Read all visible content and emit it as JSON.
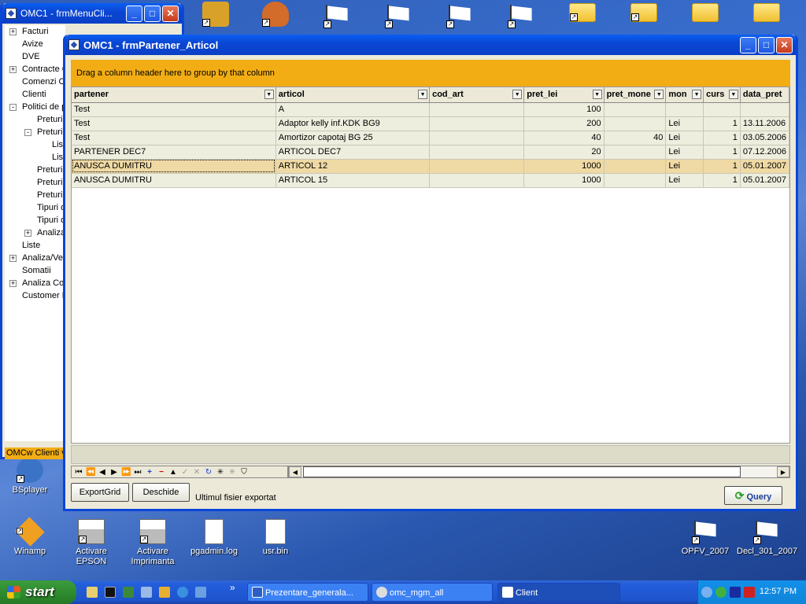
{
  "desktop": {
    "icons": [
      {
        "name": "bsplayer",
        "label": "BSplayer"
      },
      {
        "name": "winamp",
        "label": "Winamp"
      },
      {
        "name": "activare-epson",
        "label": "Activare EPSON"
      },
      {
        "name": "activare-imprimanta",
        "label": "Activare Imprimanta"
      },
      {
        "name": "pgadmin-log",
        "label": "pgadmin.log"
      },
      {
        "name": "usr-bin",
        "label": "usr.bin"
      },
      {
        "name": "opfv-2007",
        "label": "OPFV_2007"
      },
      {
        "name": "decl-301-2007",
        "label": "Decl_301_2007"
      }
    ]
  },
  "tree_window": {
    "title": "OMC1 - frmMenuCli...",
    "items": [
      {
        "label": "Facturi",
        "level": 0,
        "toggle": "+"
      },
      {
        "label": "Avize",
        "level": 0,
        "toggle": ""
      },
      {
        "label": "DVE",
        "level": 0,
        "toggle": ""
      },
      {
        "label": "Contracte C",
        "level": 0,
        "toggle": "+"
      },
      {
        "label": "Comenzi Cli",
        "level": 0,
        "toggle": ""
      },
      {
        "label": "Clienti",
        "level": 0,
        "toggle": ""
      },
      {
        "label": "Politici de p",
        "level": 0,
        "toggle": "-"
      },
      {
        "label": "Preturi d",
        "level": 1,
        "toggle": ""
      },
      {
        "label": "Preturi p",
        "level": 1,
        "toggle": "-"
      },
      {
        "label": "List",
        "level": 2,
        "toggle": ""
      },
      {
        "label": "List",
        "level": 2,
        "toggle": ""
      },
      {
        "label": "Preturi p",
        "level": 1,
        "toggle": ""
      },
      {
        "label": "Preturi p",
        "level": 1,
        "toggle": ""
      },
      {
        "label": "Preturi p",
        "level": 1,
        "toggle": ""
      },
      {
        "label": "Tipuri d",
        "level": 1,
        "toggle": ""
      },
      {
        "label": "Tipuri d",
        "level": 1,
        "toggle": ""
      },
      {
        "label": "Analiza",
        "level": 1,
        "toggle": "+"
      },
      {
        "label": "Liste",
        "level": 0,
        "toggle": ""
      },
      {
        "label": "Analiza/Ver",
        "level": 0,
        "toggle": "+"
      },
      {
        "label": "Somatii",
        "level": 0,
        "toggle": ""
      },
      {
        "label": "Analiza Cor",
        "level": 0,
        "toggle": "+"
      },
      {
        "label": "Customer R",
        "level": 0,
        "toggle": ""
      }
    ],
    "status": "OMCw Clienti v."
  },
  "main_window": {
    "title": "OMC1 - frmPartener_Articol",
    "group_hint": "Drag a column header here to group by that column",
    "columns": [
      "partener",
      "articol",
      "cod_art",
      "pret_lei",
      "pret_mone",
      "mon",
      "curs",
      "data_pret"
    ],
    "rows": [
      [
        "Test",
        "A",
        "",
        "100",
        "",
        "",
        "",
        ""
      ],
      [
        "Test",
        "Adaptor kelly inf.KDK BG9",
        "",
        "200",
        "",
        "Lei",
        "1",
        "13.11.2006"
      ],
      [
        "Test",
        "Amortizor capotaj BG 25",
        "",
        "40",
        "40",
        "Lei",
        "1",
        "03.05.2006"
      ],
      [
        "PARTENER DEC7",
        "ARTICOL DEC7",
        "",
        "20",
        "",
        "Lei",
        "1",
        "07.12.2006"
      ],
      [
        "ANUSCA DUMITRU",
        "ARTICOL 12",
        "",
        "1000",
        "",
        "Lei",
        "1",
        "05.01.2007"
      ],
      [
        "ANUSCA DUMITRU",
        "ARTICOL 15",
        "",
        "1000",
        "",
        "Lei",
        "1",
        "05.01.2007"
      ]
    ],
    "selected_row": 4,
    "buttons": {
      "export": "ExportGrid",
      "open": "Deschide",
      "query": "Query"
    },
    "export_label": "Ultimul fisier exportat"
  },
  "taskbar": {
    "start": "start",
    "tasks": [
      "Prezentare_generala...",
      "omc_mgm_all",
      "Client"
    ],
    "clock": "12:57 PM"
  },
  "colors": {
    "accent_orange": "#f2ad14",
    "xp_blue": "#0a46d6",
    "selected_row": "#efd9a4"
  }
}
